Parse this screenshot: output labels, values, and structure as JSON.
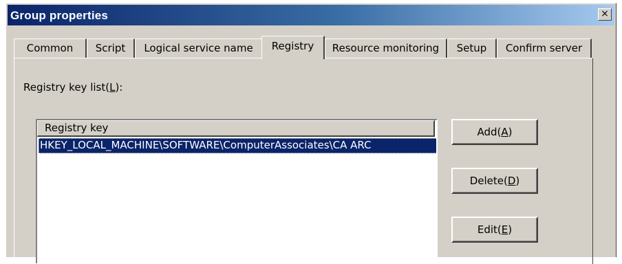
{
  "window": {
    "title": "Group properties",
    "close_glyph": "×"
  },
  "tabs": [
    {
      "label": "Common",
      "active": false
    },
    {
      "label": "Script",
      "active": false
    },
    {
      "label": "Logical service name",
      "active": false
    },
    {
      "label": "Registry",
      "active": true
    },
    {
      "label": "Resource monitoring",
      "active": false
    },
    {
      "label": "Setup",
      "active": false
    },
    {
      "label": "Confirm server",
      "active": false
    }
  ],
  "registry": {
    "list_label_prefix": "Registry key list(",
    "list_label_key": "L",
    "list_label_suffix": "):",
    "column_header": "Registry key",
    "rows": [
      "HKEY_LOCAL_MACHINE\\SOFTWARE\\ComputerAssociates\\CA ARC"
    ]
  },
  "buttons": {
    "add": {
      "prefix": "Add(",
      "key": "A",
      "suffix": ")"
    },
    "delete": {
      "prefix": "Delete(",
      "key": "D",
      "suffix": ")"
    },
    "edit": {
      "prefix": "Edit(",
      "key": "E",
      "suffix": ")"
    }
  },
  "colors": {
    "title_gradient_start": "#0a246a",
    "title_gradient_end": "#a6caf0",
    "dialog_face": "#d4d0c8",
    "selection": "#0a246a"
  }
}
